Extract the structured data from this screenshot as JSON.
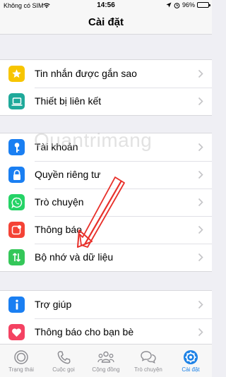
{
  "status_bar": {
    "carrier": "Không có SIM",
    "time": "14:56",
    "battery": "96%",
    "battery_level": 0.96
  },
  "nav": {
    "title": "Cài đặt"
  },
  "groups": [
    {
      "items": [
        {
          "label": "Tin nhắn được gắn sao",
          "icon": "star-icon",
          "icon_color": "#f7c500"
        },
        {
          "label": "Thiết bị liên kết",
          "icon": "laptop-icon",
          "icon_color": "#1fa99a"
        }
      ]
    },
    {
      "items": [
        {
          "label": "Tài khoản",
          "icon": "key-icon",
          "icon_color": "#1a7ff2"
        },
        {
          "label": "Quyền riêng tư",
          "icon": "lock-icon",
          "icon_color": "#1a7ff2"
        },
        {
          "label": "Trò chuyện",
          "icon": "whatsapp-icon",
          "icon_color": "#25d366"
        },
        {
          "label": "Thông báo",
          "icon": "notification-icon",
          "icon_color": "#f44336"
        },
        {
          "label": "Bộ nhớ và dữ liệu",
          "icon": "data-transfer-icon",
          "icon_color": "#34c759"
        }
      ]
    },
    {
      "items": [
        {
          "label": "Trợ giúp",
          "icon": "info-icon",
          "icon_color": "#1a7ff2"
        },
        {
          "label": "Thông báo cho bạn bè",
          "icon": "heart-icon",
          "icon_color": "#f44262"
        }
      ]
    }
  ],
  "watermark": "Quantrimang",
  "tabs": [
    {
      "label": "Trạng thái",
      "icon": "status-icon",
      "active": false
    },
    {
      "label": "Cuộc gọi",
      "icon": "phone-icon",
      "active": false
    },
    {
      "label": "Cộng đồng",
      "icon": "community-icon",
      "active": false
    },
    {
      "label": "Trò chuyện",
      "icon": "chats-icon",
      "active": false
    },
    {
      "label": "Cài đặt",
      "icon": "settings-icon",
      "active": true
    }
  ],
  "colors": {
    "accent": "#1e82e6",
    "annotation_arrow": "#e8302a"
  }
}
